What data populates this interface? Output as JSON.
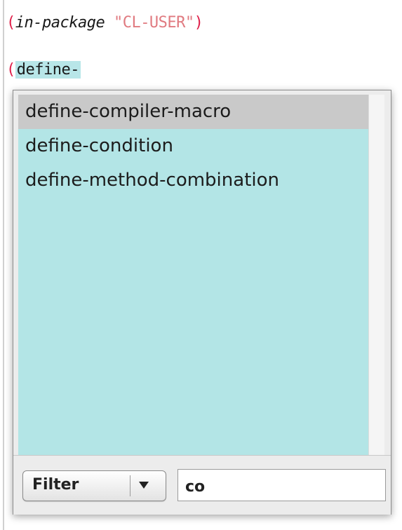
{
  "editor": {
    "line1": {
      "open_paren": "(",
      "keyword": "in-package",
      "string": "\"CL-USER\"",
      "close_paren": ")"
    },
    "line2": {
      "open_paren": "(",
      "typed": "define-"
    }
  },
  "completion": {
    "items": [
      {
        "label": "define-compiler-macro",
        "selected": true
      },
      {
        "label": "define-condition",
        "selected": false
      },
      {
        "label": "define-method-combination",
        "selected": false
      }
    ],
    "filter_button_label": "Filter",
    "filter_arrow_icon": "chevron-down-icon",
    "filter_input_value": "co"
  },
  "colors": {
    "paren": "#e0204a",
    "string": "#e07a80",
    "list_background": "#b3e5e6",
    "selected_row": "#c9c9c9"
  }
}
